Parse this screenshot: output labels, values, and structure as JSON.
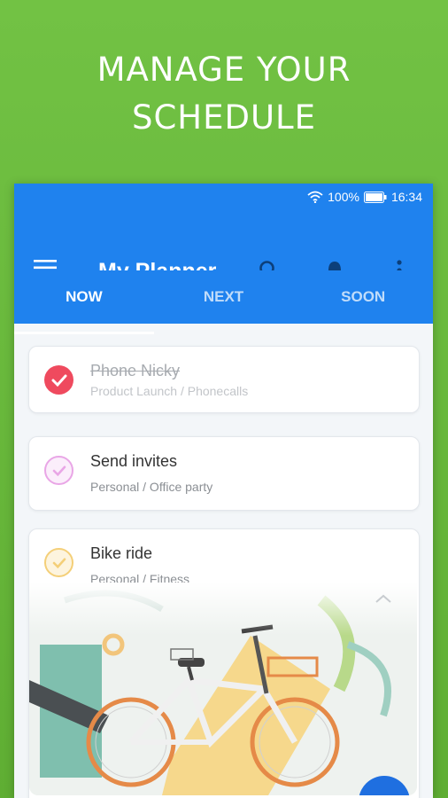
{
  "promo": {
    "line1": "MANAGE YOUR",
    "line2": "SCHEDULE"
  },
  "status_bar": {
    "battery": "100%",
    "time": "16:34"
  },
  "app_bar": {
    "title": "My Planner",
    "icons": [
      "menu-icon",
      "search-icon",
      "bell-icon",
      "more-vert-icon"
    ]
  },
  "tabs": [
    {
      "label": "NOW",
      "active": true
    },
    {
      "label": "NEXT",
      "active": false
    },
    {
      "label": "SOON",
      "active": false
    }
  ],
  "tasks": [
    {
      "title": "Phone Nicky",
      "subtitle": "Product Launch / Phonecalls",
      "done": true,
      "color": "#ef4a5e"
    },
    {
      "title": "Send invites",
      "subtitle": "Personal / Office party",
      "done": false,
      "color": "#e9a6e6"
    },
    {
      "title": "Bike ride",
      "subtitle": "Personal / Fitness",
      "done": false,
      "color": "#f4cf78"
    }
  ],
  "colors": {
    "background": "#6bbb3e",
    "app_bar": "#1f82ee",
    "fab": "#1f6fe0"
  }
}
